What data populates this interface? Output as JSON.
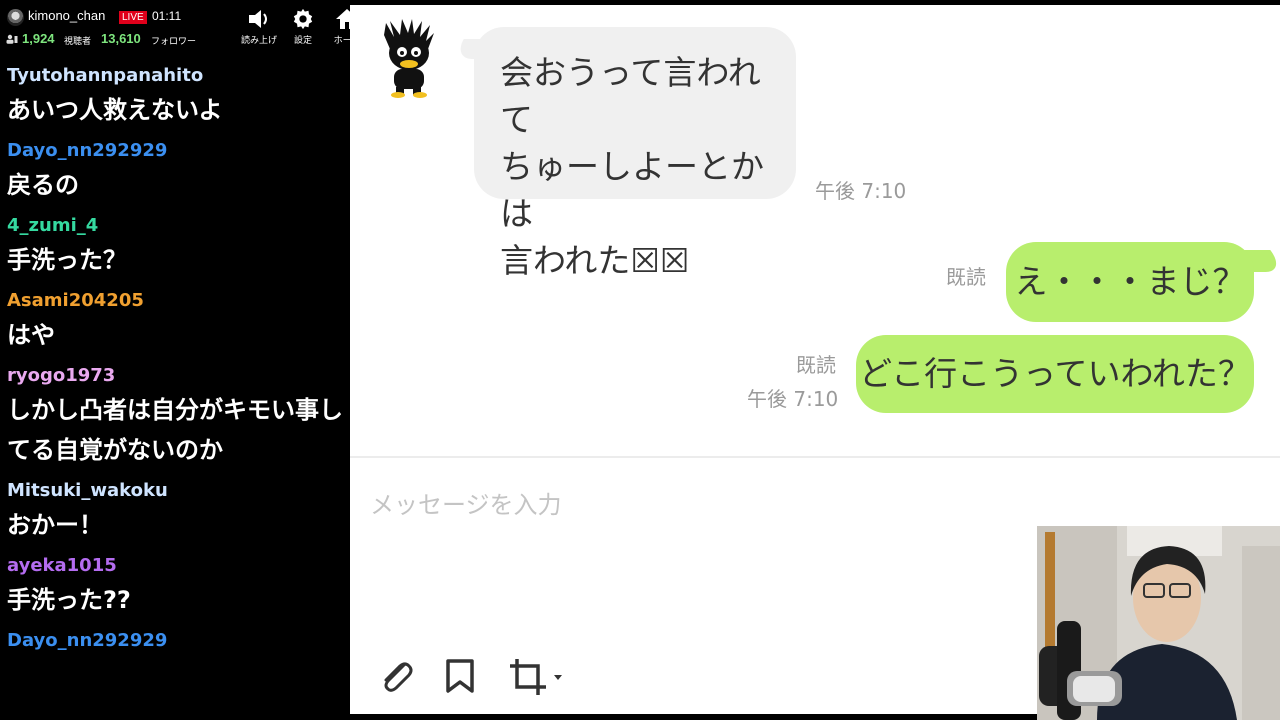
{
  "topbar": {
    "channel_name": "kimono_chan",
    "live_label": "LIVE",
    "elapsed": "01:11",
    "viewers": "1,924",
    "viewers_label": "視聴者",
    "followers": "13,610",
    "followers_label": "フォロワー",
    "tools": [
      {
        "label": "読み上げ",
        "icon": "speaker-icon"
      },
      {
        "label": "設定",
        "icon": "gear-icon"
      },
      {
        "label": "ホーム",
        "icon": "home-icon"
      }
    ]
  },
  "comments": [
    {
      "user": "Tyutohannpanahito",
      "color": "#cfe4ff",
      "text": "あいつ人救えないよ"
    },
    {
      "user": "Dayo_nn292929",
      "color": "#3b8ff0",
      "text": "戻るの"
    },
    {
      "user": "4_zumi_4",
      "color": "#35d9a0",
      "text": "手洗った？"
    },
    {
      "user": "Asami204205",
      "color": "#f0a030",
      "text": "はや"
    },
    {
      "user": "ryogo1973",
      "color": "#e9a9ef",
      "text": "しかし凸者は自分がキモい事してる自覚がないのか"
    },
    {
      "user": "Mitsuki_wakoku",
      "color": "#cfe4ff",
      "text": "おかー！"
    },
    {
      "user": "ayeka1015",
      "color": "#b46cf0",
      "text": "手洗った??"
    },
    {
      "user": "Dayo_nn292929",
      "color": "#3b8ff0",
      "text": ""
    }
  ],
  "chat": {
    "incoming": {
      "lines": [
        "会おうって言われて",
        "ちゅーしよーとかは",
        "言われた☒☒"
      ],
      "time": "午後 7:10"
    },
    "outgoing": [
      {
        "read": "既読",
        "time": "",
        "text": "え・・・まじ？"
      },
      {
        "read": "既読",
        "time": "午後 7:10",
        "text": "どこ行こうっていわれた？"
      }
    ],
    "input_placeholder": "メッセージを入力",
    "actions": [
      "paperclip-icon",
      "bookmark-icon",
      "crop-icon"
    ],
    "colors": {
      "incoming_bubble": "#f0f0f0",
      "outgoing_bubble": "#b8ee6d"
    }
  }
}
